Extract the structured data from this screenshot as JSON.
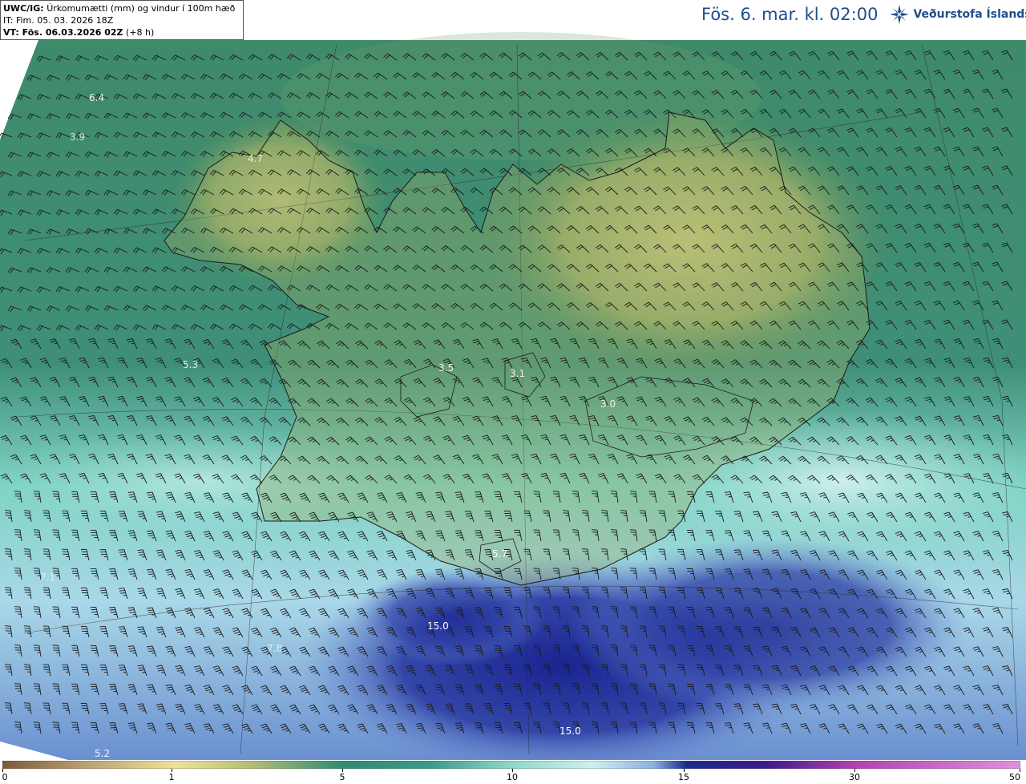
{
  "header": {
    "product_code": "UWC/IG:",
    "product_desc": "Úrkomumætti (mm) og vindur í 100m hæð",
    "issue_time": "IT: Fim. 05. 03. 2026 18Z",
    "valid_prefix": "VT: Fös. 06.03.2026 02Z",
    "valid_offset": "(+8 h)"
  },
  "title": {
    "datetime": "Fös. 6. mar. kl. 02:00",
    "agency": "Veðurstofa Íslands",
    "logo_icon": "vedurstofa-snowflake-logo"
  },
  "map": {
    "field": "precipitable water",
    "units": "mm",
    "value_labels": [
      "6.4",
      "3.9",
      "4.7",
      "5.3",
      "3.5",
      "3.1",
      "3.0",
      "5.7",
      "7.1",
      "15.0",
      "7.8",
      "15.0",
      "5.2"
    ],
    "wind_barbs": "wind barbs at 100 m",
    "coastline": "Iceland coastline"
  },
  "colorbar": {
    "ticks": [
      "0",
      "1",
      "5",
      "10",
      "15",
      "30",
      "50"
    ],
    "colors": [
      "#7a5a3a",
      "#c9b074",
      "#eee29a",
      "#2f8a74",
      "#3a9a8a",
      "#8fd8cc",
      "#cdeff0",
      "#8ab0e0",
      "#1a2a8a",
      "#3a1a8c",
      "#b040b0",
      "#e090e0"
    ]
  }
}
